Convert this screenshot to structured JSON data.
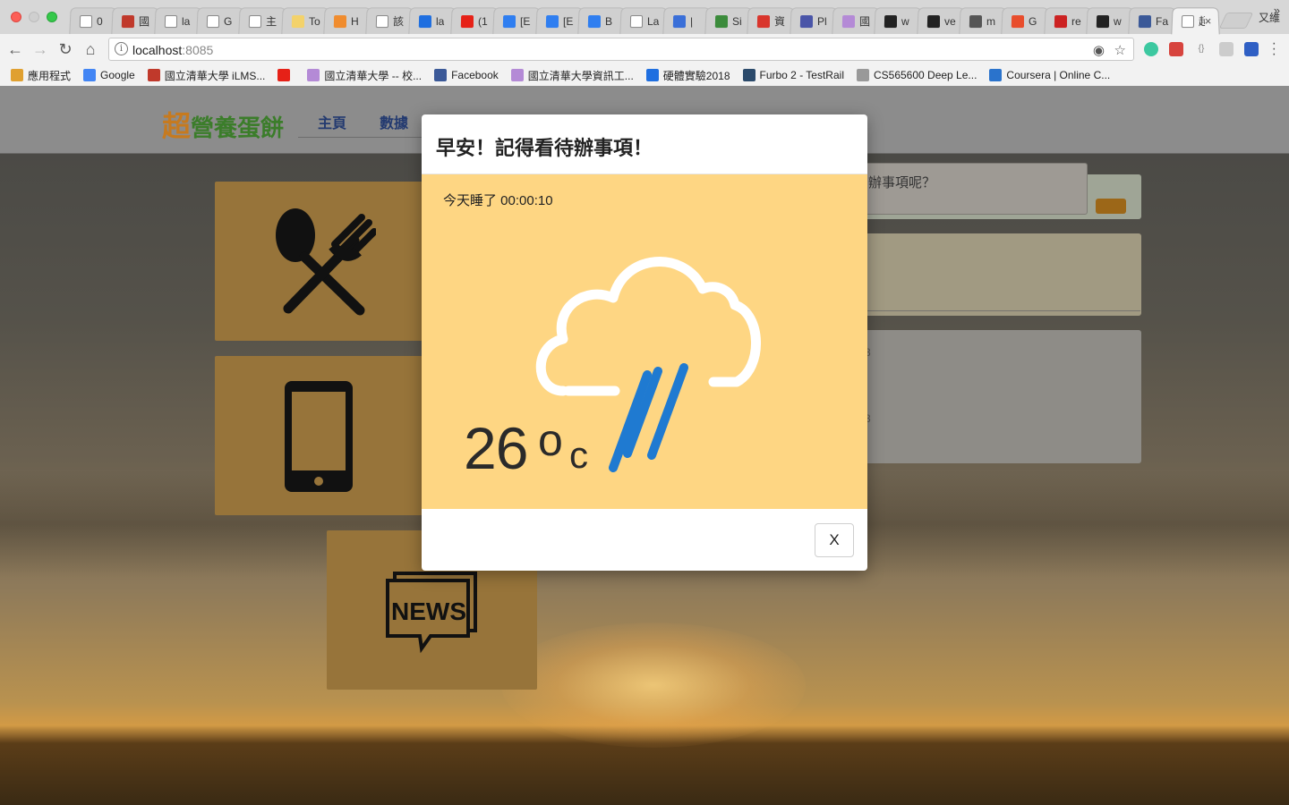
{
  "browser": {
    "tabs": [
      {
        "title": "0",
        "icon": "document-icon",
        "color": "#ffffff"
      },
      {
        "title": "國",
        "icon": "ilms-icon",
        "color": "#c0392b"
      },
      {
        "title": "la",
        "icon": "document-icon",
        "color": "#ffffff"
      },
      {
        "title": "G",
        "icon": "document-icon",
        "color": "#ffffff"
      },
      {
        "title": "主",
        "icon": "wikipedia-icon",
        "color": "#ffffff"
      },
      {
        "title": "To",
        "icon": "todo-icon",
        "color": "#f3d26b"
      },
      {
        "title": "H",
        "icon": "loading-icon",
        "color": "#f08c2e"
      },
      {
        "title": "該",
        "icon": "edit-icon",
        "color": "#ffffff"
      },
      {
        "title": "la",
        "icon": "dropbox-icon",
        "color": "#1f6fe0"
      },
      {
        "title": "(1",
        "icon": "youtube-icon",
        "color": "#e62117"
      },
      {
        "title": "[E",
        "icon": "jira-icon",
        "color": "#2f7ef0"
      },
      {
        "title": "[E",
        "icon": "jira-icon",
        "color": "#2f7ef0"
      },
      {
        "title": "B",
        "icon": "confluence-icon",
        "color": "#2f7ef0"
      },
      {
        "title": "La",
        "icon": "document-icon",
        "color": "#ffffff"
      },
      {
        "title": "|",
        "icon": "chat-icon",
        "color": "#3a6fd8"
      },
      {
        "title": "Si",
        "icon": "mygov-icon",
        "color": "#3b8b3b"
      },
      {
        "title": "資",
        "icon": "pdf-icon",
        "color": "#d9352c"
      },
      {
        "title": "Pl",
        "icon": "teams-icon",
        "color": "#4a55a8"
      },
      {
        "title": "國",
        "icon": "nthu-icon",
        "color": "#b48ad6"
      },
      {
        "title": "w",
        "icon": "github-icon",
        "color": "#222222"
      },
      {
        "title": "ve",
        "icon": "github-icon",
        "color": "#222222"
      },
      {
        "title": "m",
        "icon": "book-icon",
        "color": "#555555"
      },
      {
        "title": "G",
        "icon": "git-icon",
        "color": "#e84d2c"
      },
      {
        "title": "re",
        "icon": "redmine-icon",
        "color": "#cc2222"
      },
      {
        "title": "w",
        "icon": "github-icon",
        "color": "#222222"
      },
      {
        "title": "Fa",
        "icon": "facebook-icon",
        "color": "#3b5998"
      },
      {
        "title": "超",
        "icon": "",
        "color": "#ffffff",
        "active": true
      }
    ],
    "profile_name": "又維",
    "url_host": "localhost",
    "url_port": ":8085",
    "bookmarks": [
      {
        "label": "應用程式",
        "icon": "apps-icon",
        "color": "#e0a030"
      },
      {
        "label": "Google",
        "icon": "google-icon",
        "color": "#4285f4"
      },
      {
        "label": "國立清華大學 iLMS...",
        "icon": "ilms-icon",
        "color": "#c0392b"
      },
      {
        "label": "",
        "icon": "youtube-icon",
        "color": "#e62117"
      },
      {
        "label": "國立清華大學 -- 校...",
        "icon": "nthu-icon",
        "color": "#b48ad6"
      },
      {
        "label": "Facebook",
        "icon": "facebook-icon",
        "color": "#3b5998"
      },
      {
        "label": "國立清華大學資訊工...",
        "icon": "nthu-icon",
        "color": "#b48ad6"
      },
      {
        "label": "硬體實驗2018",
        "icon": "dropbox-icon",
        "color": "#1f6fe0"
      },
      {
        "label": "Furbo 2 - TestRail",
        "icon": "testrail-icon",
        "color": "#2b4a6b"
      },
      {
        "label": "CS565600 Deep Le...",
        "icon": "nthu-icon",
        "color": "#999999"
      },
      {
        "label": "Coursera | Online C...",
        "icon": "coursera-icon",
        "color": "#2a73cc"
      }
    ]
  },
  "site": {
    "brand_big": "超",
    "brand_rest": "營養蛋餅",
    "nav": [
      "主頁",
      "數據"
    ],
    "todo_placeholder_fragment": "辦事項呢？",
    "list_fragments": [
      "3",
      "3"
    ],
    "cards": [
      "food-icon",
      "phone-icon",
      "news-icon"
    ],
    "news_text": "NEWS"
  },
  "modal": {
    "title": "早安！記得看待辦事項！",
    "sleep_text": "今天睡了 00:00:10",
    "temperature": "26",
    "degree": "o",
    "unit": "c",
    "weather_icon": "rain-cloud-icon",
    "close_label": "X"
  },
  "colors": {
    "modal_body": "#fed683",
    "rain": "#1f7ad1",
    "brand_green": "#3b7d2a",
    "brand_orange": "#c67a1f",
    "card": "#97743a"
  }
}
